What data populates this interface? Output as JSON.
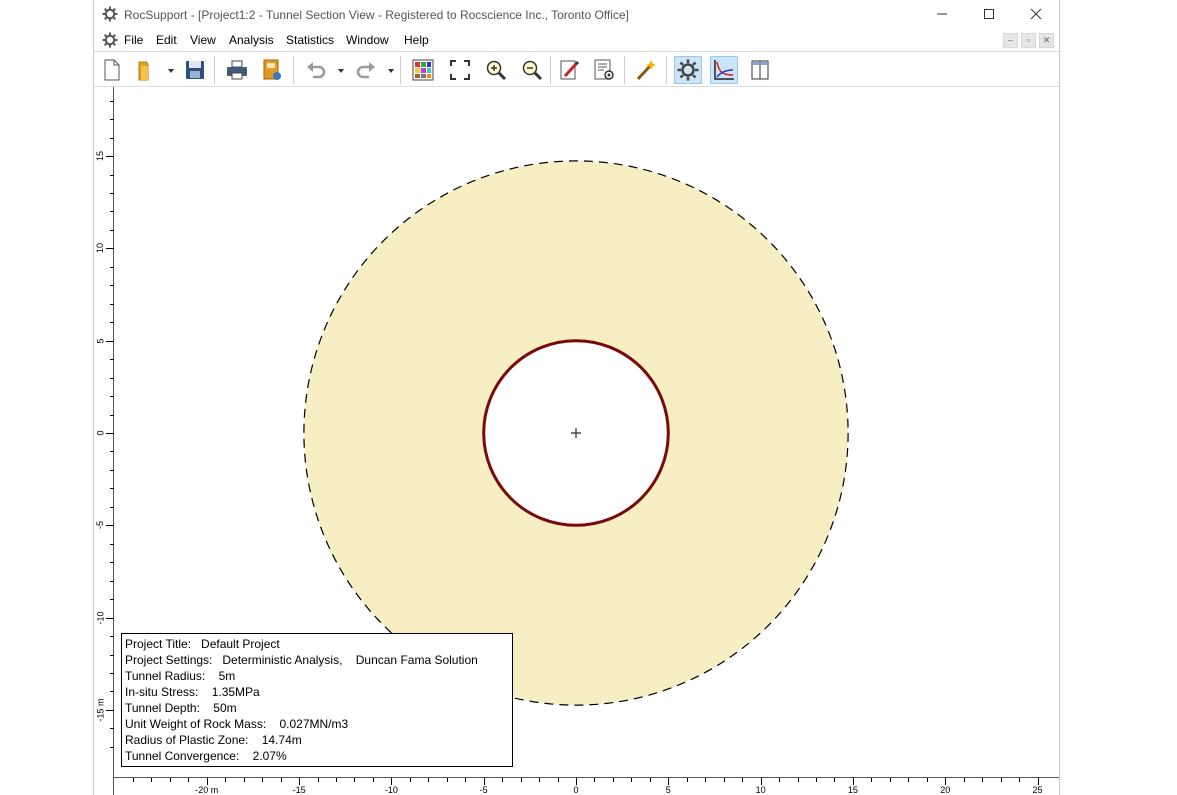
{
  "window": {
    "title": "RocSupport - [Project1:2 - Tunnel Section View - Registered to Rocscience Inc., Toronto Office]"
  },
  "menu": {
    "items": [
      "File",
      "Edit",
      "View",
      "Analysis",
      "Statistics",
      "Window",
      "Help"
    ]
  },
  "toolbar": {
    "icons": [
      "new-file-icon",
      "open-folder-icon",
      "save-icon",
      "print-icon",
      "export-image-icon",
      "undo-icon",
      "redo-icon",
      "color-grid-icon",
      "zoom-extents-icon",
      "zoom-in-icon",
      "zoom-out-icon",
      "edit-icon",
      "settings-sheet-icon",
      "wand-icon",
      "compute-gear-icon",
      "chart-icon",
      "columns-icon"
    ]
  },
  "rulers": {
    "vertical_labels": [
      "15",
      "10",
      "5",
      "0",
      "-5",
      "-10",
      "-15 m"
    ],
    "horizontal_labels": [
      "-20 m",
      "-15",
      "-10",
      "-5",
      "0",
      "5",
      "10",
      "15",
      "20",
      "25"
    ]
  },
  "model": {
    "tunnel_radius": 5,
    "plastic_radius": 14.74,
    "plastic_zone_color": "#f7efc3",
    "tunnel_color": "#7a0a0a"
  },
  "info": {
    "lines": [
      "Project Title:   Default Project",
      "Project Settings:   Deterministic Analysis,    Duncan Fama Solution",
      "Tunnel Radius:    5m",
      "In-situ Stress:    1.35MPa",
      "Tunnel Depth:    50m",
      "Unit Weight of Rock Mass:    0.027MN/m3",
      "Radius of Plastic Zone:    14.74m",
      "Tunnel Convergence:    2.07%"
    ]
  }
}
